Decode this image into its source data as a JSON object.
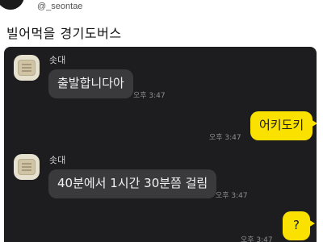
{
  "tweet": {
    "handle": "@_seontae",
    "text": "빌어먹을 경기도버스"
  },
  "chat": {
    "messages": [
      {
        "sender": "솟대",
        "text": "출발합니다아",
        "time": "오후 3:47",
        "direction": "in"
      },
      {
        "text": "어키도키",
        "time": "오후 3:47",
        "direction": "out"
      },
      {
        "sender": "솟대",
        "text": "40분에서 1시간 30분쯤 걸림",
        "time": "오후 3:47",
        "direction": "in"
      },
      {
        "text": "?",
        "time": "오후 3:47",
        "direction": "out"
      }
    ]
  },
  "colors": {
    "chat_background": "#1d1d1f",
    "incoming_bubble": "#3a3a3c",
    "outgoing_bubble": "#fae100"
  }
}
